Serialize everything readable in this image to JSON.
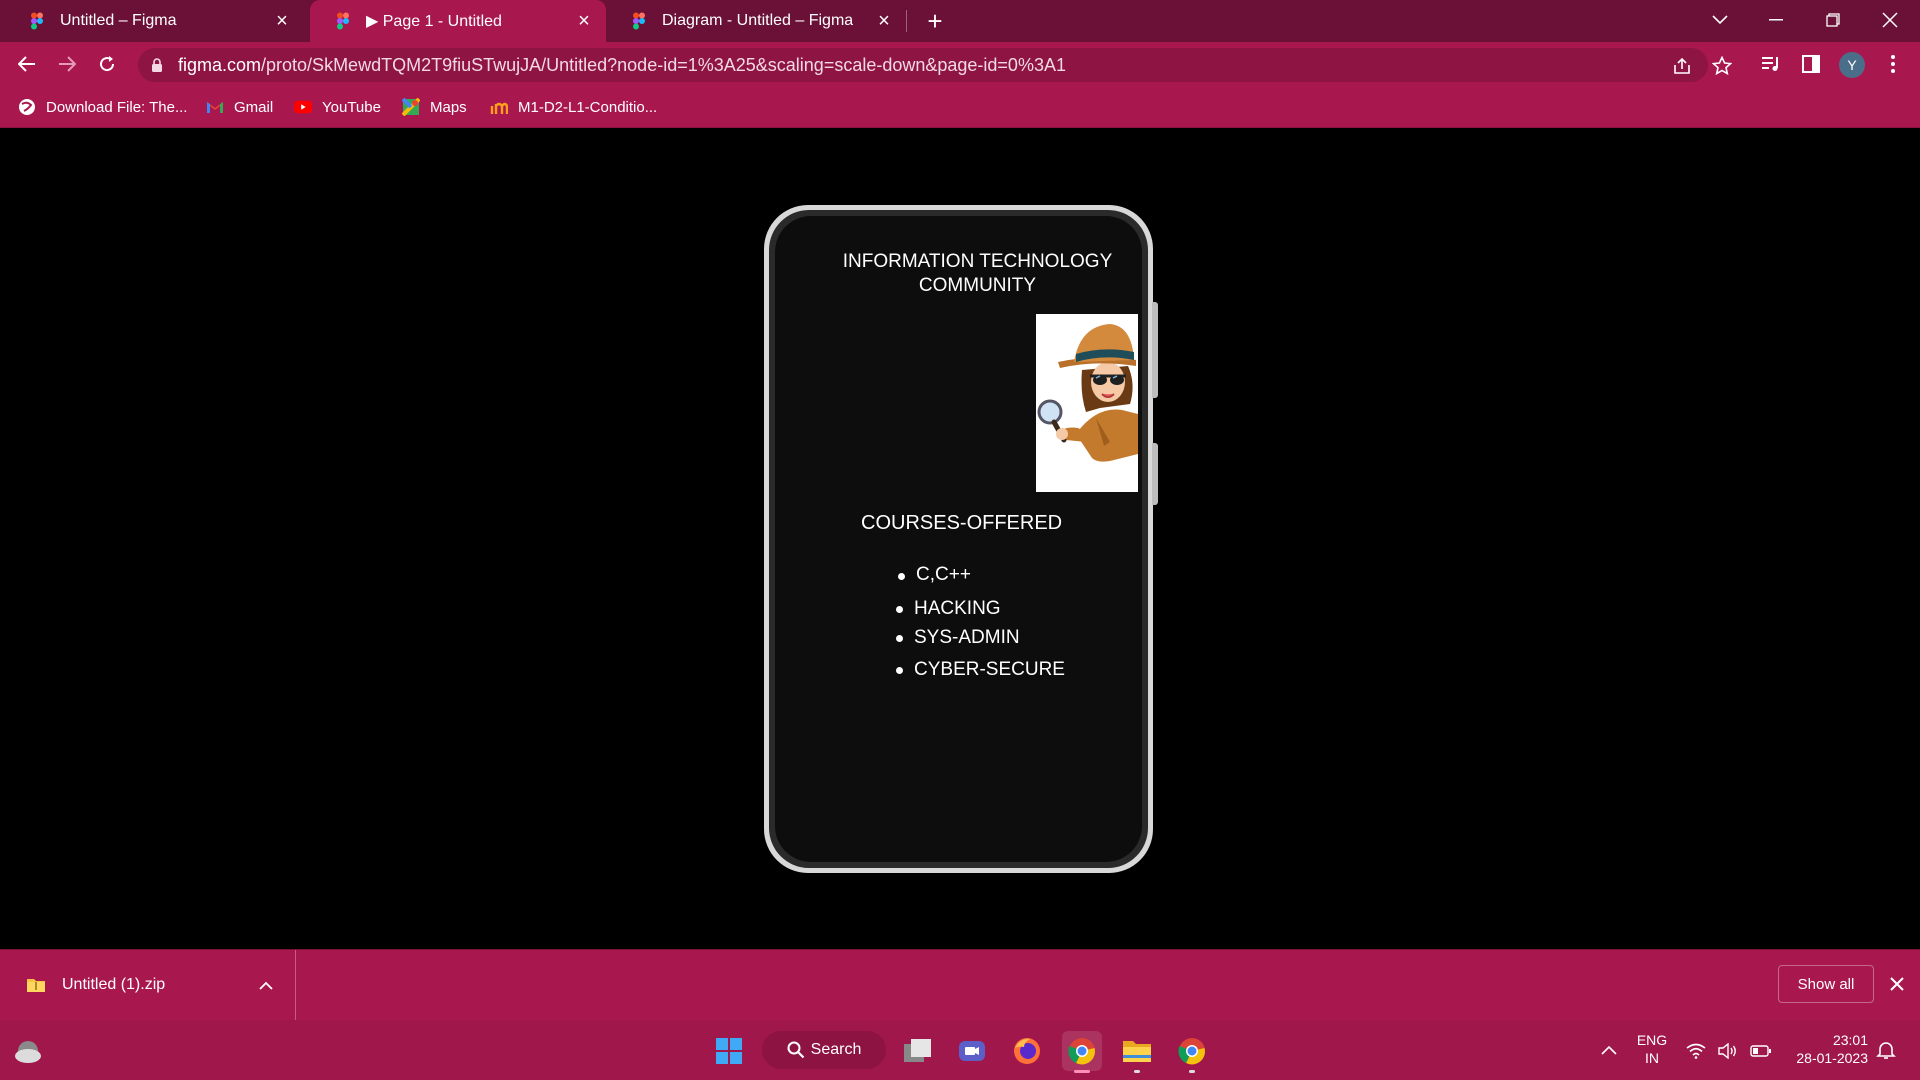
{
  "browser": {
    "tabs": [
      {
        "label": "Untitled – Figma",
        "active": false
      },
      {
        "label": "▶ Page 1 - Untitled",
        "active": true
      },
      {
        "label": "Diagram - Untitled – Figma",
        "active": false
      }
    ],
    "url_host": "figma.com",
    "url_path": "/proto/SkMewdTQM2T9fiuSTwujJA/Untitled?node-id=1%3A25&scaling=scale-down&page-id=0%3A1",
    "profile_initial": "Y",
    "bookmarks": [
      "Download File: The...",
      "Gmail",
      "YouTube",
      "Maps",
      "M1-D2-L1-Conditio..."
    ]
  },
  "prototype": {
    "title_line1": "INFORMATION TECHNOLOGY",
    "title_line2": "COMMUNITY",
    "courses_heading": "COURSES-OFFERED",
    "courses": [
      "C,C++",
      "HACKING",
      "SYS-ADMIN",
      "CYBER-SECURE"
    ]
  },
  "downloads": {
    "file_name": "Untitled (1).zip",
    "show_all_label": "Show all"
  },
  "taskbar": {
    "search_label": "Search",
    "language_line1": "ENG",
    "language_line2": "IN",
    "time": "23:01",
    "date": "28-01-2023"
  },
  "colors": {
    "titlebar": "#6b1037",
    "toolbar": "#a8184f",
    "taskbar": "#a0174b"
  }
}
